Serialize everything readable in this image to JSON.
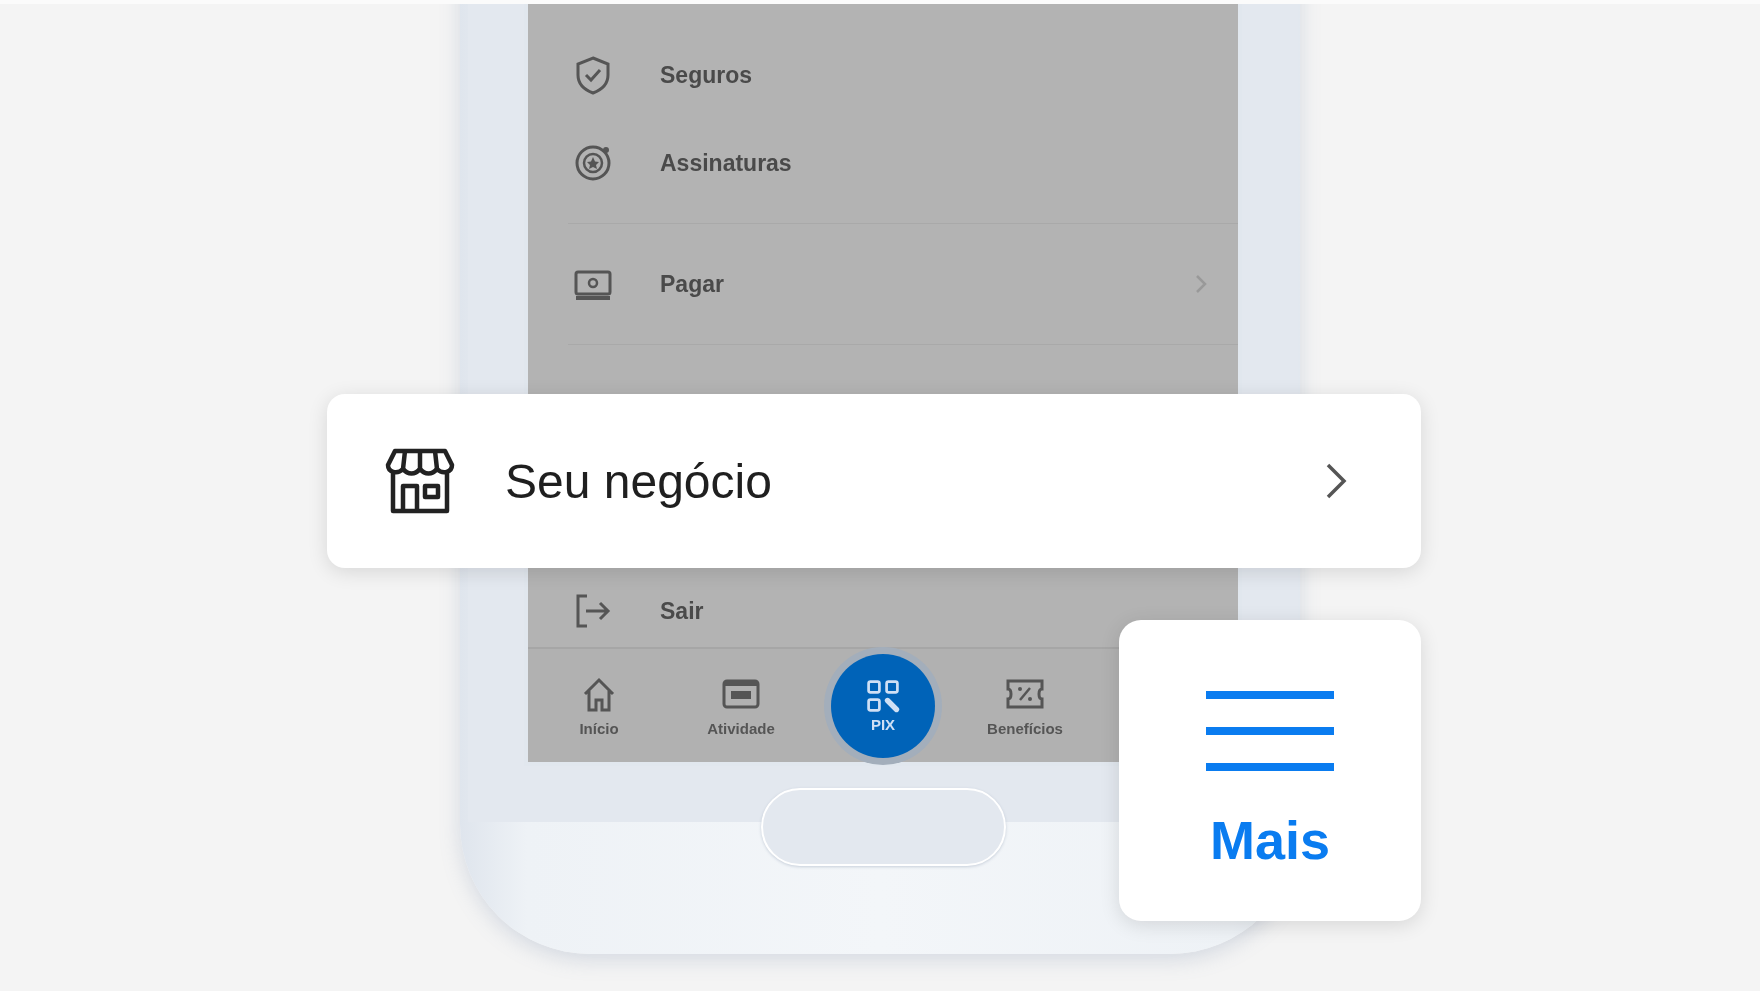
{
  "menu": {
    "groups": [
      {
        "items": [
          {
            "label": "Seguros",
            "chevron": false
          },
          {
            "label": "Assinaturas",
            "chevron": false
          }
        ]
      },
      {
        "items": [
          {
            "label": "Pagar",
            "chevron": true
          }
        ]
      },
      {
        "items": [
          {
            "label": "Sair",
            "chevron": false
          }
        ]
      }
    ]
  },
  "tab_bar": {
    "items": [
      {
        "label": "Início",
        "kind": "tab"
      },
      {
        "label": "Atividade",
        "kind": "tab"
      },
      {
        "label": "PIX",
        "kind": "fab"
      },
      {
        "label": "Benefícios",
        "kind": "tab"
      }
    ]
  },
  "feature_card": {
    "label": "Seu negócio"
  },
  "more_card": {
    "label": "Mais"
  }
}
